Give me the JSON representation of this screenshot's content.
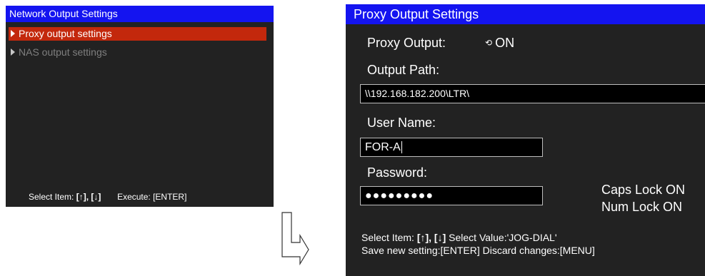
{
  "left_panel": {
    "title": "Network Output Settings",
    "menu_items": [
      {
        "label": "Proxy output settings",
        "state": "selected"
      },
      {
        "label": "NAS output settings",
        "state": "disabled"
      }
    ],
    "footer": {
      "select_item_label": "Select Item:",
      "up_key": "[↑],",
      "down_key": "[↓]",
      "execute_label": "Execute: [ENTER]"
    }
  },
  "right_panel": {
    "title": "Proxy Output Settings",
    "proxy_output": {
      "label": "Proxy Output:",
      "value": "ON",
      "icon": "cycle-icon"
    },
    "output_path": {
      "label": "Output Path:",
      "value": "\\\\192.168.182.200\\LTR\\"
    },
    "user_name": {
      "label": "User Name:",
      "value": "FOR-A"
    },
    "password": {
      "label": "Password:",
      "value": "●●●●●●●●●"
    },
    "caps_lock": "Caps Lock ON",
    "num_lock": "Num Lock ON",
    "footer": {
      "line1_select_item": "Select Item:",
      "line1_keys": "[↑], [↓]",
      "line1_select_value": "Select Value:'JOG-DIAL'",
      "line2": "Save new setting:[ENTER] Discard changes:[MENU]"
    }
  },
  "colors": {
    "panel_bg": "#222222",
    "titlebar": "#1414f0",
    "selection": "#c3280c",
    "disabled_text": "#7f7f7f"
  }
}
